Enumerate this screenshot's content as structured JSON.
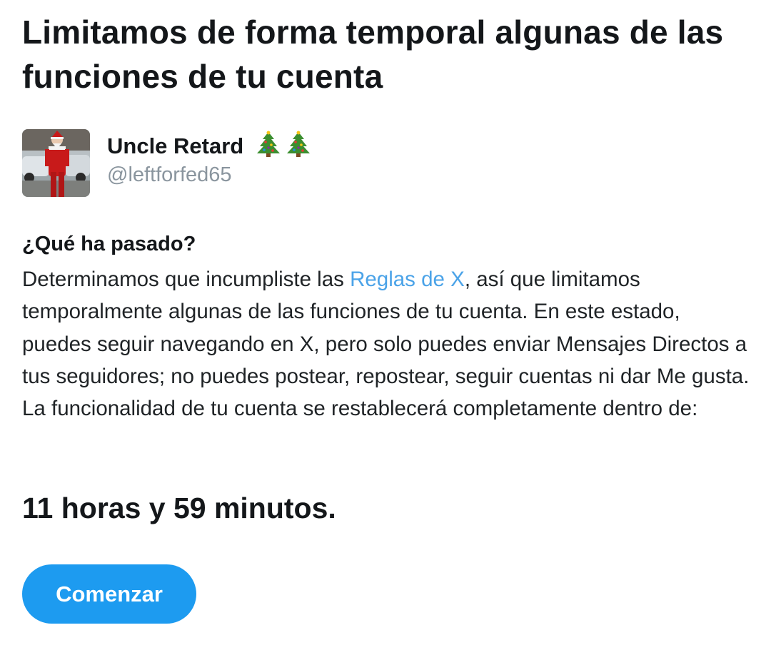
{
  "title": "Limitamos de forma temporal algunas de las funciones de tu cuenta",
  "account": {
    "name": "Uncle Retard",
    "name_emoji": [
      "christmas-tree",
      "christmas-tree"
    ],
    "handle": "@leftforfed65"
  },
  "section": {
    "heading": "¿Qué ha pasado?",
    "body_before_link": "Determinamos que incumpliste las ",
    "link_text": "Reglas de X",
    "body_after_link": ", así que limitamos temporalmente algunas de las funciones de tu cuenta. En este estado, puedes seguir navegando en X, pero solo puedes enviar Mensajes Directos a tus seguidores; no puedes postear, repostear, seguir cuentas ni dar Me gusta. La funcionalidad de tu cuenta se restablecerá completamente dentro de:"
  },
  "countdown": "11 horas y 59 minutos.",
  "start_button_label": "Comenzar",
  "colors": {
    "text": "#14171a",
    "secondary_text": "#8a959e",
    "link": "#4ba3e8",
    "button": "#1d9bf0",
    "button_text": "#ffffff"
  }
}
